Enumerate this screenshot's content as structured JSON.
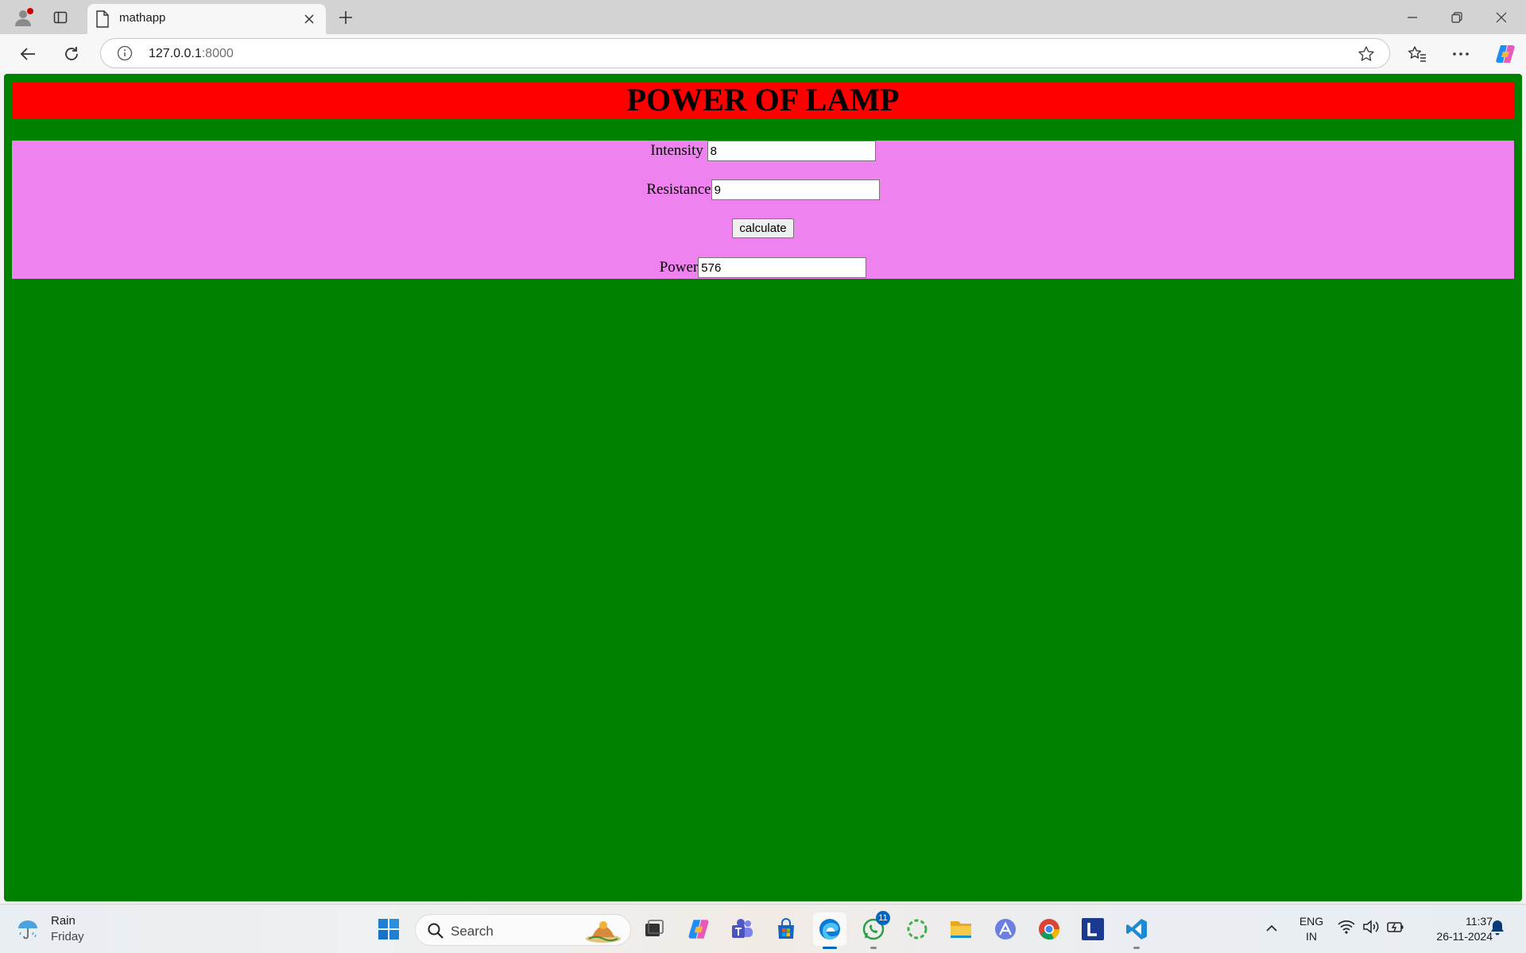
{
  "browser": {
    "tab_title": "mathapp",
    "url_host": "127.0.0.1",
    "url_port": ":8000"
  },
  "page": {
    "heading": "POWER OF LAMP",
    "intensity_label": "Intensity",
    "intensity_value": "8",
    "resistance_label": "Resistance",
    "resistance_value": "9",
    "calculate_label": "calculate",
    "power_label": "Power",
    "power_value": "576",
    "colors": {
      "background": "#008000",
      "header": "#ff0000",
      "panel": "#ee82ee"
    }
  },
  "taskbar": {
    "weather_title": "Rain",
    "weather_day": "Friday",
    "search_label": "Search",
    "whatsapp_badge": "11",
    "lang_1": "ENG",
    "lang_2": "IN",
    "time": "11:37",
    "date": "26-11-2024"
  }
}
